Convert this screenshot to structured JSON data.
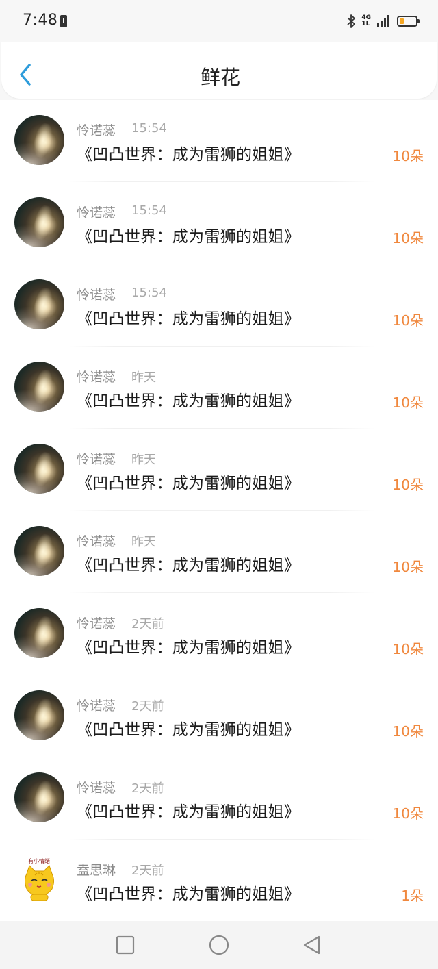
{
  "status_bar": {
    "time": "7:48",
    "network_top": "4G",
    "network_bottom": "1L",
    "battery_level": 0.25,
    "battery_color": "#f5a623"
  },
  "header": {
    "title": "鲜花"
  },
  "colors": {
    "accent": "#2d9cdb",
    "flower_count": "#f0883e"
  },
  "items": [
    {
      "name": "怜诺蕊",
      "time": "15:54",
      "title": "《凹凸世界：成为雷狮的姐姐》",
      "count": "10朵",
      "avatar": "photo-avatar"
    },
    {
      "name": "怜诺蕊",
      "time": "15:54",
      "title": "《凹凸世界：成为雷狮的姐姐》",
      "count": "10朵",
      "avatar": "photo-avatar"
    },
    {
      "name": "怜诺蕊",
      "time": "15:54",
      "title": "《凹凸世界：成为雷狮的姐姐》",
      "count": "10朵",
      "avatar": "photo-avatar"
    },
    {
      "name": "怜诺蕊",
      "time": "昨天",
      "title": "《凹凸世界：成为雷狮的姐姐》",
      "count": "10朵",
      "avatar": "photo-avatar"
    },
    {
      "name": "怜诺蕊",
      "time": "昨天",
      "title": "《凹凸世界：成为雷狮的姐姐》",
      "count": "10朵",
      "avatar": "photo-avatar"
    },
    {
      "name": "怜诺蕊",
      "time": "昨天",
      "title": "《凹凸世界：成为雷狮的姐姐》",
      "count": "10朵",
      "avatar": "photo-avatar"
    },
    {
      "name": "怜诺蕊",
      "time": "2天前",
      "title": "《凹凸世界：成为雷狮的姐姐》",
      "count": "10朵",
      "avatar": "photo-avatar"
    },
    {
      "name": "怜诺蕊",
      "time": "2天前",
      "title": "《凹凸世界：成为雷狮的姐姐》",
      "count": "10朵",
      "avatar": "photo-avatar"
    },
    {
      "name": "怜诺蕊",
      "time": "2天前",
      "title": "《凹凸世界：成为雷狮的姐姐》",
      "count": "10朵",
      "avatar": "photo-avatar"
    },
    {
      "name": "盍思琳",
      "time": "2天前",
      "title": "《凹凸世界：成为雷狮的姐姐》",
      "count": "1朵",
      "avatar": "cat-avatar",
      "avatar_text": "有小情绪"
    }
  ],
  "nav": {
    "recent_icon": "square-icon",
    "home_icon": "circle-icon",
    "back_icon": "triangle-back-icon"
  }
}
